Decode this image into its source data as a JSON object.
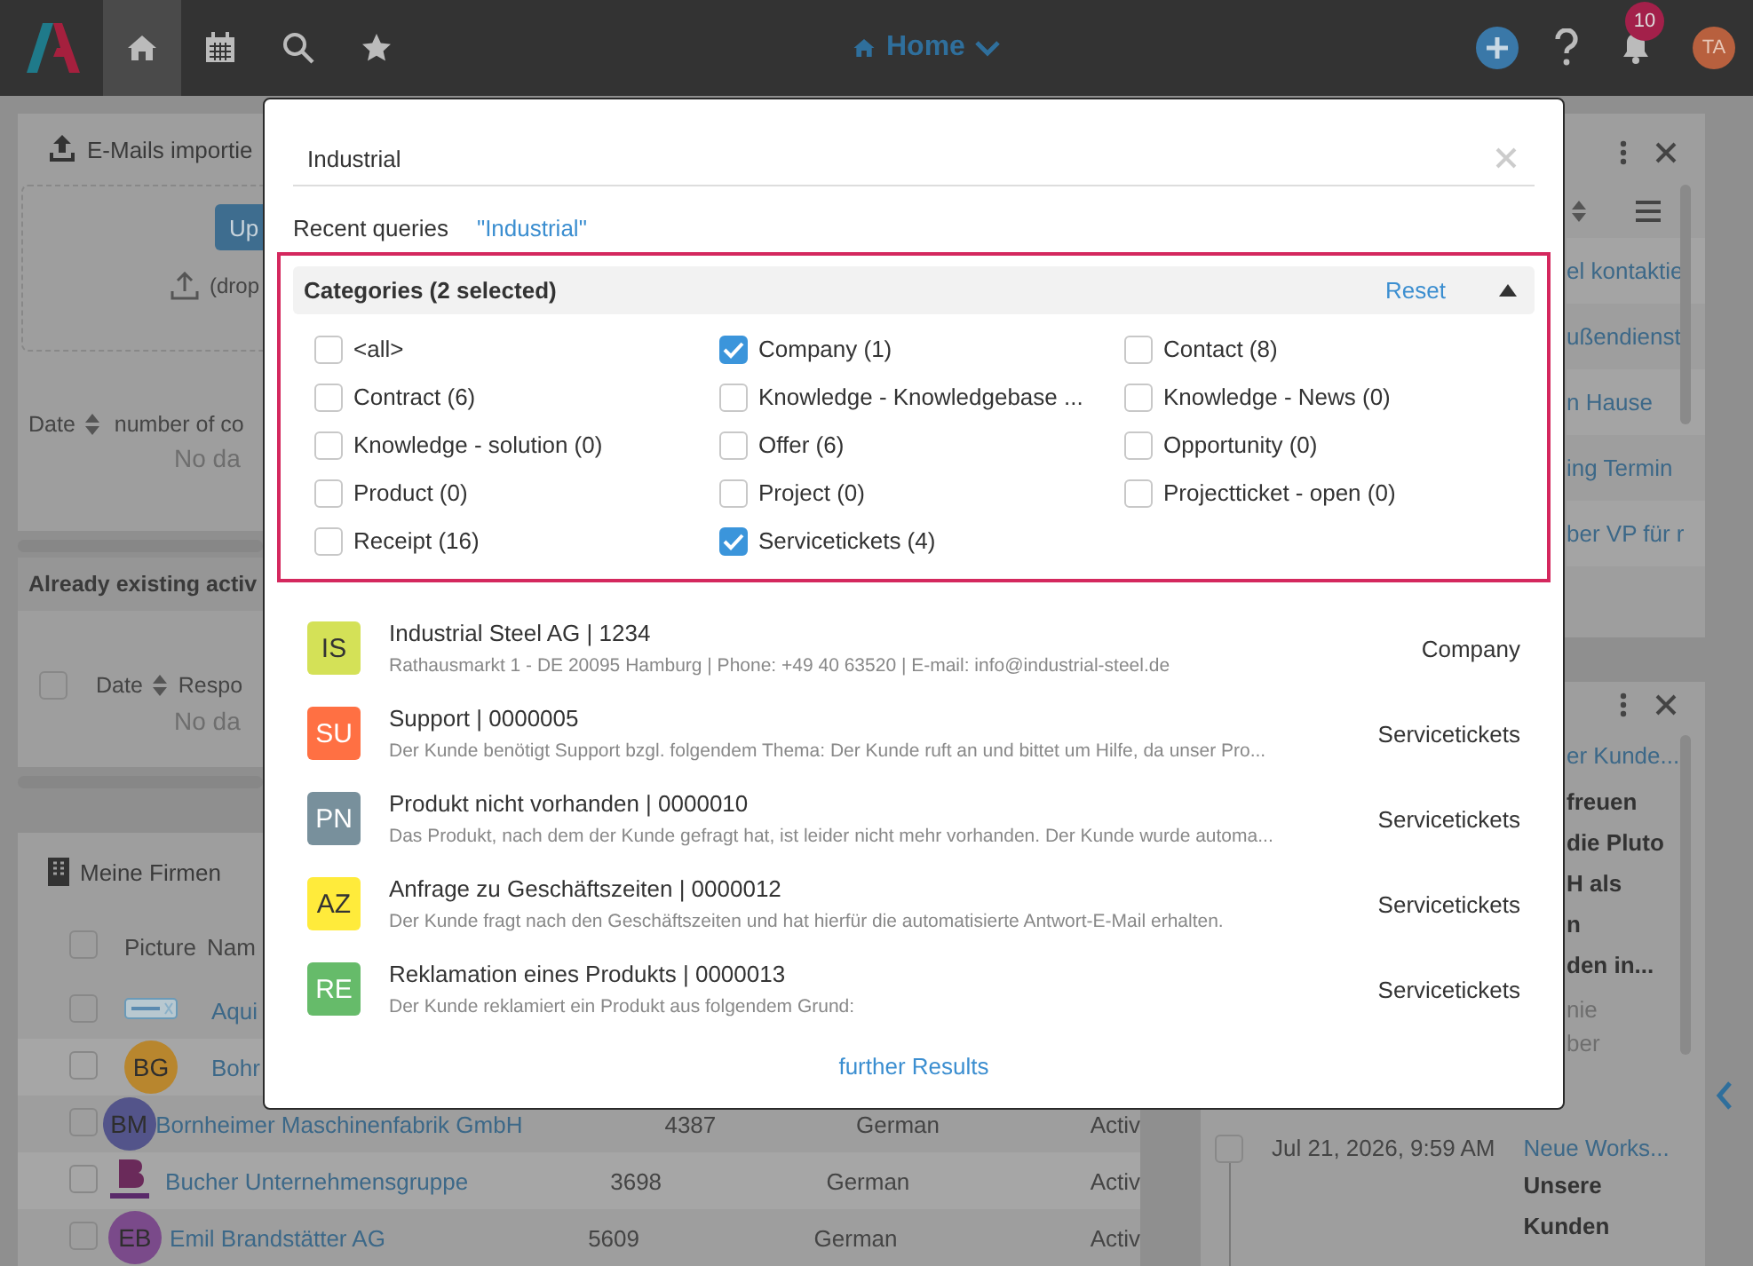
{
  "top_bar": {
    "nav_buttons": [
      {
        "selected": true
      },
      {
        "selected": false
      },
      {
        "selected": false
      },
      {
        "selected": false
      }
    ],
    "title": "Home",
    "notifications": "10",
    "avatar": "TA"
  },
  "import_panel": {
    "title": "E-Mails importie",
    "upload_button": "Up",
    "drop_hint": "(drop",
    "columns": [
      "Date",
      "number of co"
    ],
    "empty": "No da"
  },
  "activities_panel": {
    "title": "Already existing activ",
    "select_all_checked": false,
    "columns": [
      "Date",
      "Respo"
    ],
    "empty": "No da"
  },
  "companies_panel": {
    "title": "Meine Firmen",
    "select_all_checked": false,
    "columns": [
      "Picture",
      "Nam"
    ],
    "rows": [
      {
        "kind": "wordmark",
        "checked": false,
        "name": "Aqui"
      },
      {
        "kind": "avatar",
        "checked": false,
        "initials": "BG",
        "color": "#b8862e",
        "name": "Bohr"
      },
      {
        "kind": "avatar",
        "checked": false,
        "initials": "BM",
        "color": "#53548a",
        "name": "Bornheimer Maschinenfabrik GmbH",
        "number": "4387",
        "language": "German",
        "status": "Activ"
      },
      {
        "kind": "monogram",
        "checked": false,
        "name": "Bucher Unternehmensgruppe",
        "number": "3698",
        "language": "German",
        "status": "Activ"
      },
      {
        "kind": "avatar",
        "checked": false,
        "initials": "EB",
        "color": "#7a4a8a",
        "name": "Emil Brandstätter AG",
        "number": "5609",
        "language": "German",
        "status": "Activ"
      }
    ]
  },
  "tasks_panel": {
    "links": [
      "el kontaktie",
      "ußendienst",
      "n Hause",
      "ing Termin",
      "ber VP für r"
    ]
  },
  "news_panel": {
    "link": "er Kunde...",
    "bold_lines": [
      "freuen",
      "die Pluto",
      "H als",
      "n",
      "den in..."
    ],
    "muted_lines": [
      "nie",
      "ber"
    ],
    "entry": {
      "checked": false,
      "time": "Jul 21, 2026, 9:59 AM",
      "title": "Neue Works...",
      "bold_lines": [
        "Unsere",
        "Kunden"
      ]
    }
  },
  "search_dialog": {
    "search": {
      "value": "Industrial"
    },
    "recent": {
      "label": "Recent queries",
      "items": [
        "\"Industrial\""
      ]
    },
    "categories": {
      "title": "Categories (2 selected)",
      "reset": "Reset",
      "expanded": true,
      "items": [
        {
          "label": "<all>",
          "checked": false
        },
        {
          "label": "Company (1)",
          "checked": true
        },
        {
          "label": "Contact (8)",
          "checked": false
        },
        {
          "label": "Contract (6)",
          "checked": false
        },
        {
          "label": "Knowledge - Knowledgebase ...",
          "checked": false
        },
        {
          "label": "Knowledge - News (0)",
          "checked": false
        },
        {
          "label": "Knowledge - solution (0)",
          "checked": false
        },
        {
          "label": "Offer (6)",
          "checked": false
        },
        {
          "label": "Opportunity (0)",
          "checked": false
        },
        {
          "label": "Product (0)",
          "checked": false
        },
        {
          "label": "Project (0)",
          "checked": false
        },
        {
          "label": "Projectticket - open (0)",
          "checked": false
        },
        {
          "label": "Receipt (16)",
          "checked": false
        },
        {
          "label": "Servicetickets (4)",
          "checked": true
        }
      ]
    },
    "results": [
      {
        "initials": "IS",
        "color": "#d4e157",
        "title": "Industrial Steel AG | 1234",
        "subtitle": "Rathausmarkt 1 - DE 20095 Hamburg | Phone: +49 40 63520 | E-mail: info@industrial-steel.de",
        "type": "Company"
      },
      {
        "initials": "SU",
        "color": "#ff7043",
        "title": "Support | 0000005",
        "subtitle": "Der Kunde benötigt Support bzgl. folgendem Thema: Der Kunde ruft an und bittet um Hilfe, da unser Pro...",
        "type": "Servicetickets"
      },
      {
        "initials": "PN",
        "color": "#78909c",
        "title": "Produkt nicht vorhanden | 0000010",
        "subtitle": "Das Produkt, nach dem der Kunde gefragt hat, ist leider nicht mehr vorhanden. Der Kunde wurde automa...",
        "type": "Servicetickets"
      },
      {
        "initials": "AZ",
        "color": "#ffeb3b",
        "title": "Anfrage zu Geschäftszeiten | 0000012",
        "subtitle": "Der Kunde fragt nach den Geschäftszeiten und hat hierfür die automatisierte Antwort-E-Mail erhalten.",
        "type": "Servicetickets"
      },
      {
        "initials": "RE",
        "color": "#66bb6a",
        "title": "Reklamation eines Produkts | 0000013",
        "subtitle": "Der Kunde reklamiert ein Produkt aus folgendem Grund:",
        "type": "Servicetickets"
      }
    ],
    "more": "further Results"
  }
}
